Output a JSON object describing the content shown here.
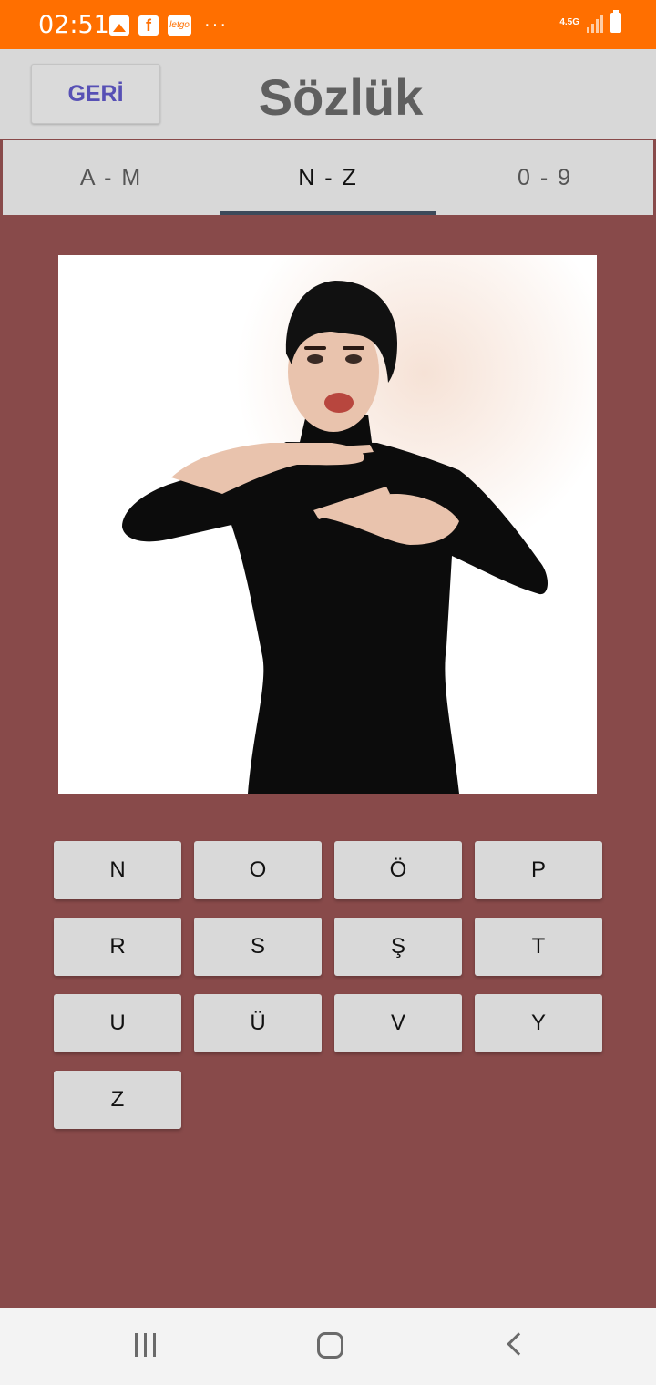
{
  "status_bar": {
    "time": "02:51",
    "network": "4.5G",
    "icons": [
      "gallery-icon",
      "facebook-icon",
      "letgo-icon",
      "more-dots-icon",
      "signal-icon",
      "battery-icon"
    ],
    "fb_glyph": "f",
    "letgo_text": "letgo",
    "more": "···"
  },
  "header": {
    "back_label": "GERİ",
    "title": "Sözlük"
  },
  "tabs": [
    {
      "label": "A - M",
      "active": false
    },
    {
      "label": "N - Z",
      "active": true
    },
    {
      "label": "0 - 9",
      "active": false
    }
  ],
  "letters": [
    "N",
    "O",
    "Ö",
    "P",
    "R",
    "S",
    "Ş",
    "T",
    "U",
    "Ü",
    "V",
    "Y",
    "Z"
  ],
  "colors": {
    "status_bar": "#ff6f00",
    "background": "#884a4a",
    "header": "#d8d8d8",
    "back_label": "#5750b5",
    "tab_indicator": "#3d4a5a"
  }
}
